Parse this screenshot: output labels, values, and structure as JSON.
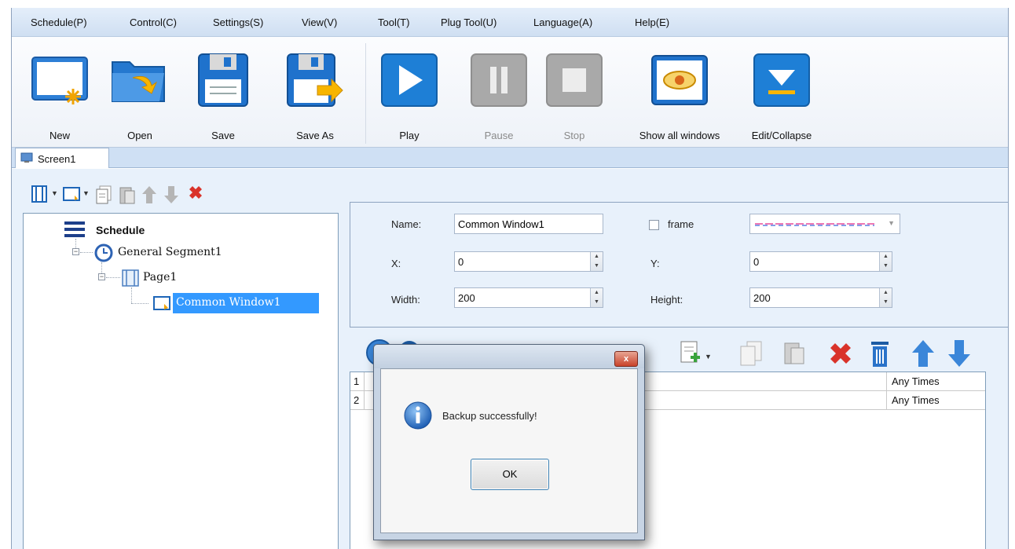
{
  "menu": [
    "Schedule(P)",
    "Control(C)",
    "Settings(S)",
    "View(V)",
    "Tool(T)",
    "Plug Tool(U)",
    "Language(A)",
    "Help(E)"
  ],
  "toolbar": {
    "new": "New",
    "open": "Open",
    "save": "Save",
    "save_as": "Save As",
    "play": "Play",
    "pause": "Pause",
    "stop": "Stop",
    "show_all": "Show all windows",
    "edit_collapse": "Edit/Collapse"
  },
  "tab": {
    "label": "Screen1"
  },
  "tree": {
    "root": "Schedule",
    "segment": "General Segment1",
    "page": "Page1",
    "window": "Common Window1"
  },
  "props": {
    "name_label": "Name:",
    "name_value": "Common Window1",
    "frame_label": "frame",
    "x_label": "X:",
    "x_value": "0",
    "y_label": "Y:",
    "y_value": "0",
    "width_label": "Width:",
    "width_value": "200",
    "height_label": "Height:",
    "height_value": "200"
  },
  "list": {
    "rows": [
      {
        "index": "1",
        "times": "Any Times"
      },
      {
        "index": "2",
        "times": "Any Times"
      }
    ]
  },
  "dialog": {
    "close_label": "x",
    "message": "Backup successfully!",
    "ok": "OK"
  },
  "colors": {
    "menubar": "#d6e4f5",
    "content": "#e8f1fb",
    "accent_blue": "#1f78d1",
    "delete_red": "#d9332a",
    "disabled_gray": "#a9a9a9"
  }
}
